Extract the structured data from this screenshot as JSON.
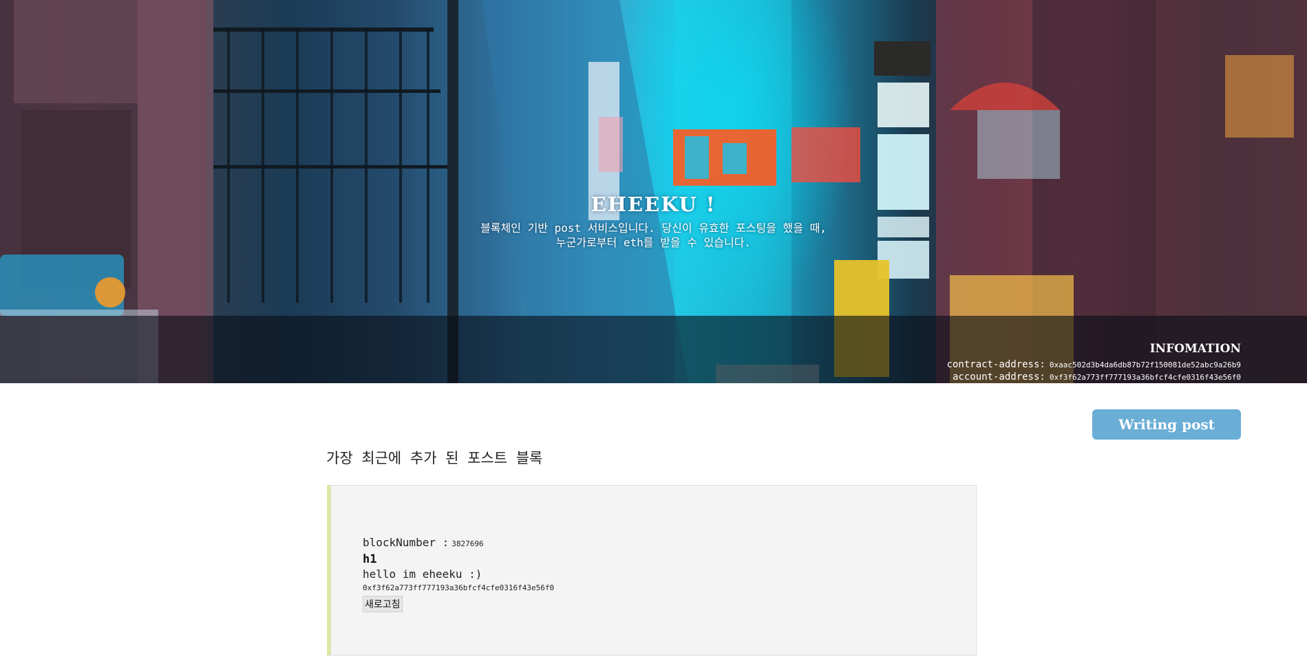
{
  "hero": {
    "title": "EHEEKU !",
    "subtitle_line1": "블록체인 기반 post 서비스입니다. 당신이 유효한 포스팅을 했을 때,",
    "subtitle_line2": "누군가로부터 eth를 받을 수 있습니다.",
    "background": "neon alley street photo"
  },
  "info": {
    "title": "INFOMATION",
    "contract_label": "contract-address:",
    "contract_address": "0xaac502d3b4da6db87b72f150081de52abc9a26b9",
    "account_label": "account-address:",
    "account_address": "0xf3f62a773ff777193a36bfcf4cfe0316f43e56f0"
  },
  "actions": {
    "write_label": "Writing post"
  },
  "main": {
    "section_title": "가장 최근에 추가 된 포스트 블록",
    "post": {
      "block_label": "blockNumber :",
      "block_number": "3827696",
      "title": "h1",
      "body": "hello im eheeku :)",
      "author_address": "0xf3f62a773ff777193a36bfcf4cfe0316f43e56f0",
      "refresh_label": "새로고침"
    }
  },
  "colors": {
    "button": "#6aaed6",
    "card_background": "#f4f4f4",
    "card_accent": "#dfe6a8"
  }
}
